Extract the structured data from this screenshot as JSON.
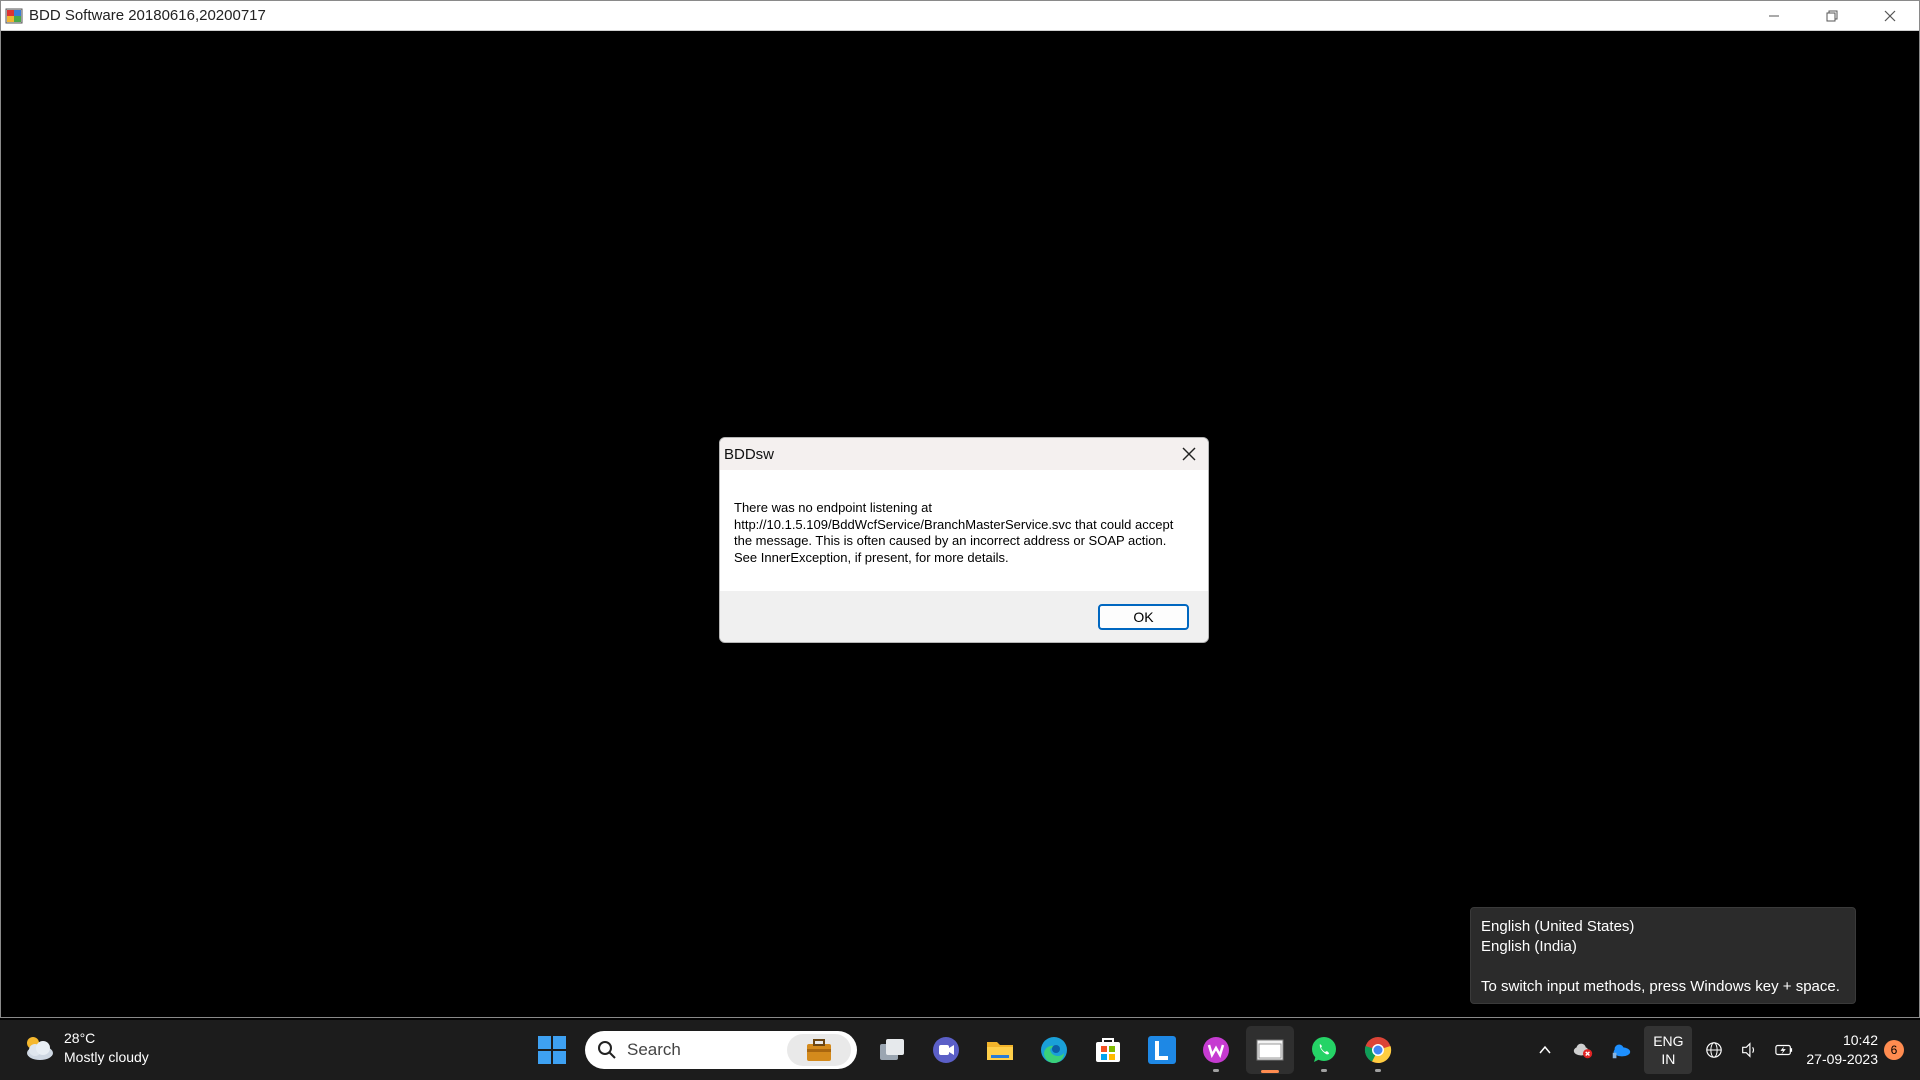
{
  "window": {
    "title": "BDD Software 20180616,20200717"
  },
  "dialog": {
    "title": "BDDsw",
    "message": "There was no endpoint listening at http://10.1.5.109/BddWcfService/BranchMasterService.svc that could accept the message. This is often caused by an incorrect address or SOAP action. See InnerException, if present, for more details.",
    "ok_label": "OK"
  },
  "language_tooltip": {
    "line1": "English (United States)",
    "line2": "English (India)",
    "hint": "To switch input methods, press Windows key + space."
  },
  "taskbar": {
    "weather": {
      "temp": "28°C",
      "condition": "Mostly cloudy"
    },
    "search_placeholder": "Search",
    "tray": {
      "lang_top": "ENG",
      "lang_bottom": "IN",
      "time": "10:42",
      "date": "27-09-2023",
      "notification_count": "6"
    }
  },
  "colors": {
    "accent": "#0067c0",
    "taskbar_bg": "#1c1c1c",
    "badge": "#ff8c50"
  }
}
